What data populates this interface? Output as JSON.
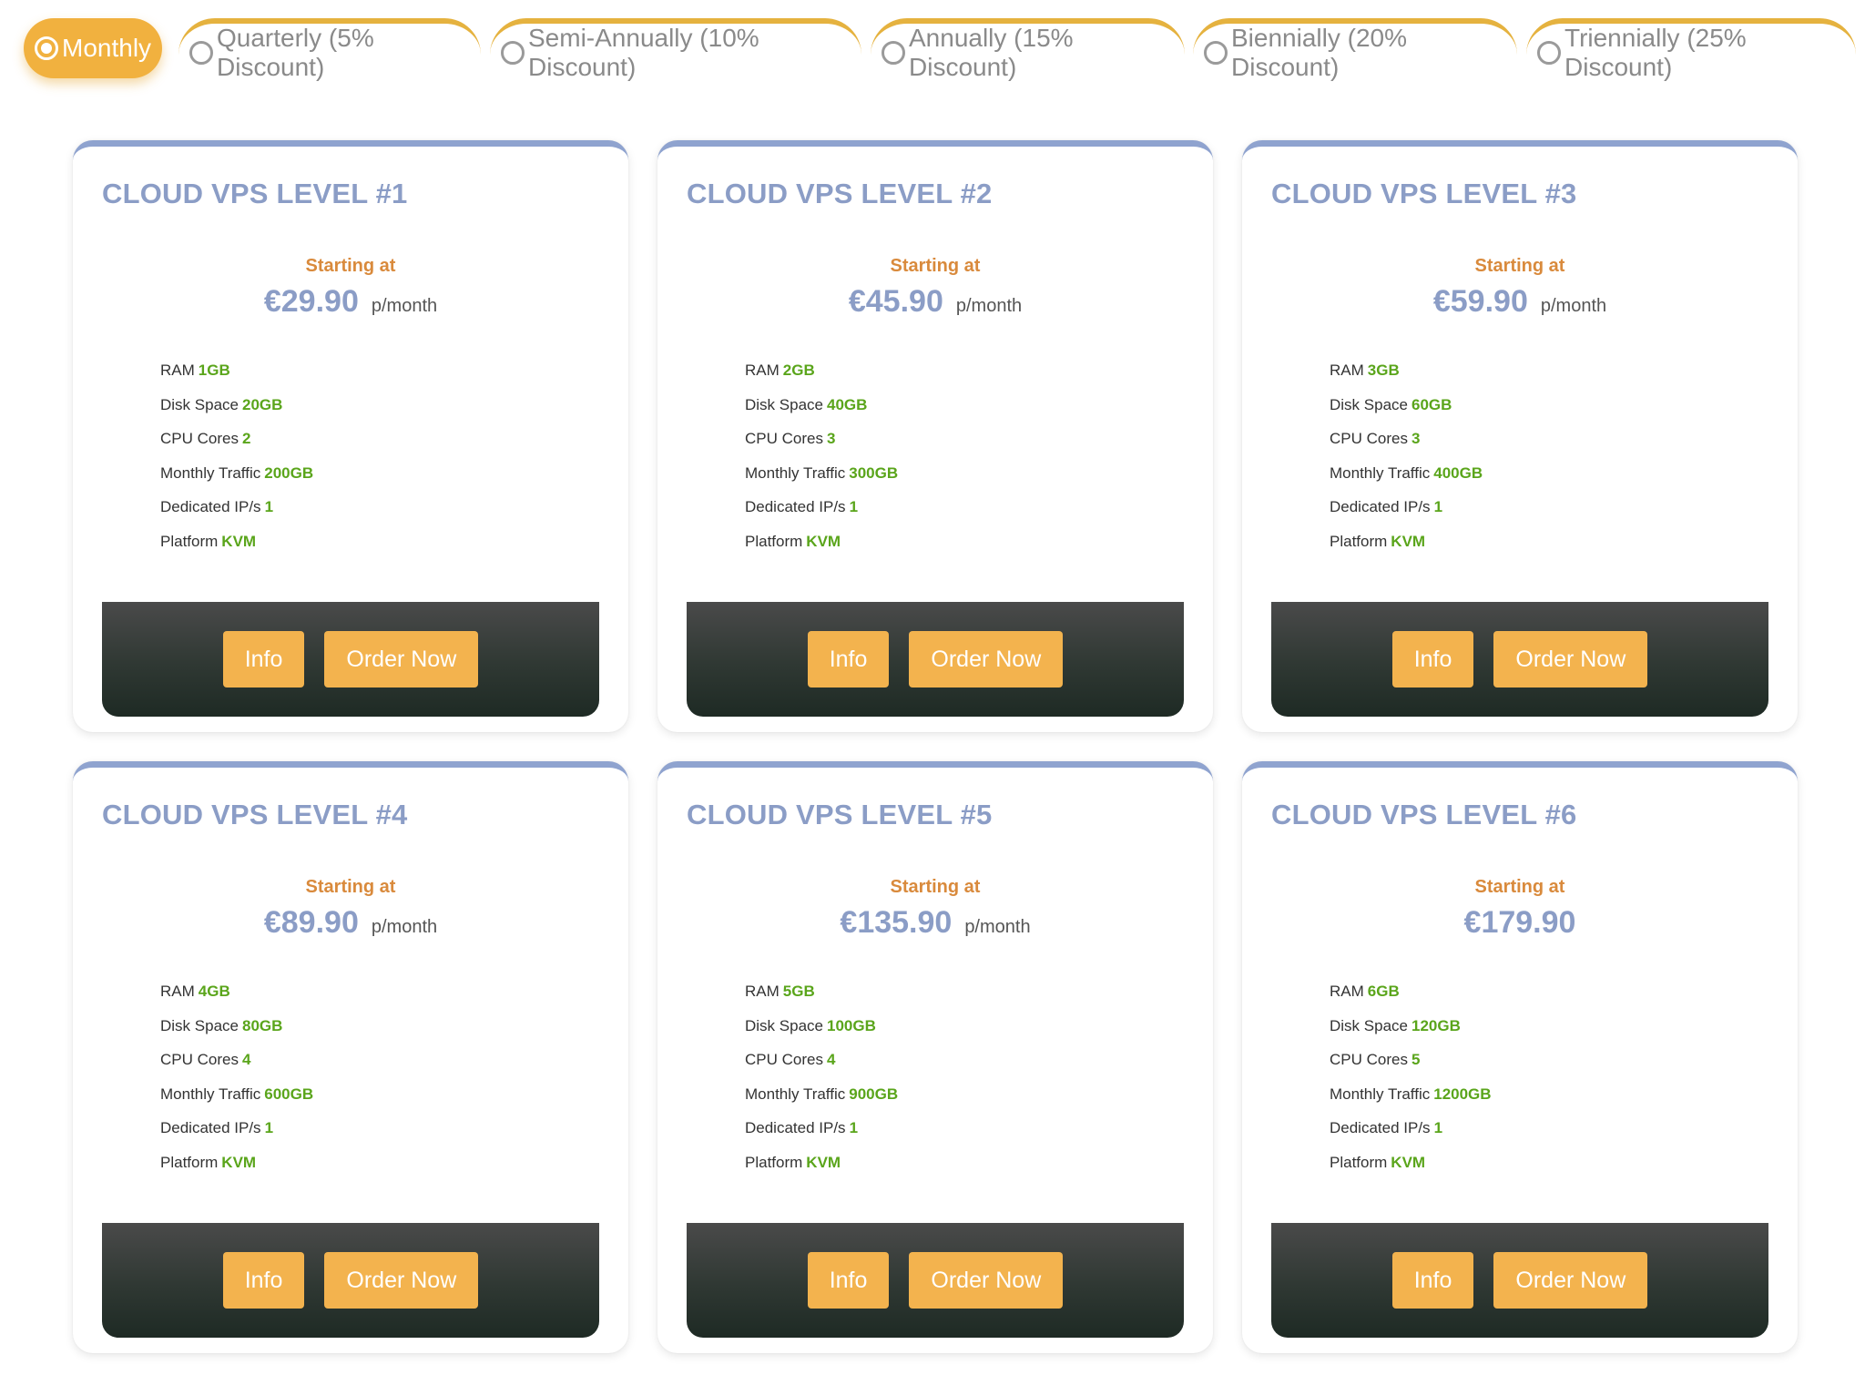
{
  "billing_tabs": [
    {
      "label": "Monthly",
      "selected": true
    },
    {
      "label": "Quarterly (5% Discount)",
      "selected": false
    },
    {
      "label": "Semi-Annually (10% Discount)",
      "selected": false
    },
    {
      "label": "Annually (15% Discount)",
      "selected": false
    },
    {
      "label": "Biennially (20% Discount)",
      "selected": false
    },
    {
      "label": "Triennially (25% Discount)",
      "selected": false
    }
  ],
  "plans": [
    {
      "title": "CLOUD VPS LEVEL #1",
      "starting_label": "Starting at",
      "price": "€29.90",
      "period": "p/month",
      "features": [
        {
          "label": "RAM",
          "value": "1GB"
        },
        {
          "label": "Disk Space",
          "value": "20GB"
        },
        {
          "label": "CPU Cores",
          "value": "2"
        },
        {
          "label": "Monthly Traffic",
          "value": "200GB"
        },
        {
          "label": "Dedicated IP/s",
          "value": "1"
        },
        {
          "label": "Platform",
          "value": "KVM"
        }
      ],
      "info_label": "Info",
      "order_label": "Order Now"
    },
    {
      "title": "CLOUD VPS LEVEL #2",
      "starting_label": "Starting at",
      "price": "€45.90",
      "period": "p/month",
      "features": [
        {
          "label": "RAM",
          "value": "2GB"
        },
        {
          "label": "Disk Space",
          "value": "40GB"
        },
        {
          "label": "CPU Cores",
          "value": "3"
        },
        {
          "label": "Monthly Traffic",
          "value": "300GB"
        },
        {
          "label": "Dedicated IP/s",
          "value": "1"
        },
        {
          "label": "Platform",
          "value": "KVM"
        }
      ],
      "info_label": "Info",
      "order_label": "Order Now"
    },
    {
      "title": "CLOUD VPS LEVEL #3",
      "starting_label": "Starting at",
      "price": "€59.90",
      "period": "p/month",
      "features": [
        {
          "label": "RAM",
          "value": "3GB"
        },
        {
          "label": "Disk Space",
          "value": "60GB"
        },
        {
          "label": "CPU Cores",
          "value": "3"
        },
        {
          "label": "Monthly Traffic",
          "value": "400GB"
        },
        {
          "label": "Dedicated IP/s",
          "value": "1"
        },
        {
          "label": "Platform",
          "value": "KVM"
        }
      ],
      "info_label": "Info",
      "order_label": "Order Now"
    },
    {
      "title": "CLOUD VPS LEVEL #4",
      "starting_label": "Starting at",
      "price": "€89.90",
      "period": "p/month",
      "features": [
        {
          "label": "RAM",
          "value": "4GB"
        },
        {
          "label": "Disk Space",
          "value": "80GB"
        },
        {
          "label": "CPU Cores",
          "value": "4"
        },
        {
          "label": "Monthly Traffic",
          "value": "600GB"
        },
        {
          "label": "Dedicated IP/s",
          "value": "1"
        },
        {
          "label": "Platform",
          "value": "KVM"
        }
      ],
      "info_label": "Info",
      "order_label": "Order Now"
    },
    {
      "title": "CLOUD VPS LEVEL #5",
      "starting_label": "Starting at",
      "price": "€135.90",
      "period": "p/month",
      "features": [
        {
          "label": "RAM",
          "value": "5GB"
        },
        {
          "label": "Disk Space",
          "value": "100GB"
        },
        {
          "label": "CPU Cores",
          "value": "4"
        },
        {
          "label": "Monthly Traffic",
          "value": "900GB"
        },
        {
          "label": "Dedicated IP/s",
          "value": "1"
        },
        {
          "label": "Platform",
          "value": "KVM"
        }
      ],
      "info_label": "Info",
      "order_label": "Order Now"
    },
    {
      "title": "CLOUD VPS LEVEL #6",
      "starting_label": "Starting at",
      "price": "€179.90",
      "period": "",
      "features": [
        {
          "label": "RAM",
          "value": "6GB"
        },
        {
          "label": "Disk Space",
          "value": "120GB"
        },
        {
          "label": "CPU Cores",
          "value": "5"
        },
        {
          "label": "Monthly Traffic",
          "value": "1200GB"
        },
        {
          "label": "Dedicated IP/s",
          "value": "1"
        },
        {
          "label": "Platform",
          "value": "KVM"
        }
      ],
      "info_label": "Info",
      "order_label": "Order Now"
    }
  ],
  "colors": {
    "accent": "#f1b13f",
    "card_title": "#8b9dc6",
    "starting_text": "#d98a3c",
    "feature_value": "#5aa51b",
    "button": "#f3b34e",
    "footer_bar": "#2f3833"
  }
}
